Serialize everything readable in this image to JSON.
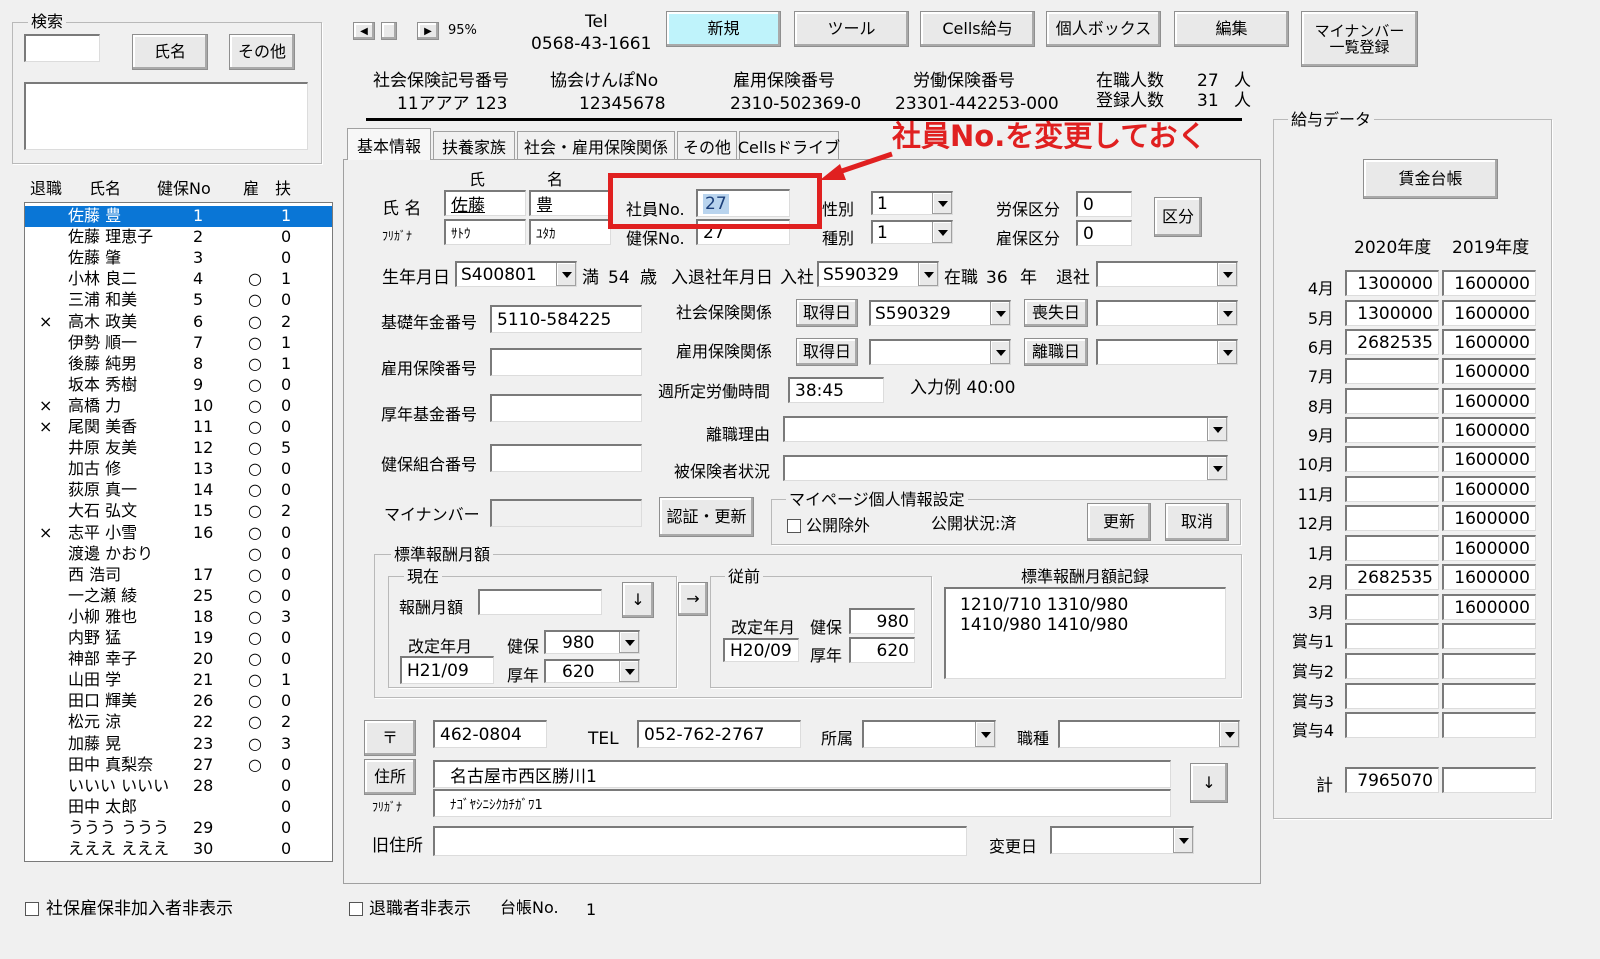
{
  "search": {
    "group_title": "検索",
    "name_button": "氏名",
    "other_button": "その他"
  },
  "topbar": {
    "zoom": "95%",
    "tel_label": "Tel",
    "tel_value": "0568-43-1661",
    "buttons": [
      "新規",
      "ツール",
      "Cells給与",
      "個人ボックス",
      "編集"
    ],
    "mynumber_button_line1": "マイナンバー",
    "mynumber_button_line2": "一覧登録"
  },
  "company": {
    "shaho_label": "社会保険記号番号",
    "shaho_value": "11アアア 123",
    "kyokai_label": "協会けんぽNo",
    "kyokai_value": "12345678",
    "koyo_label": "雇用保険番号",
    "koyo_value": "2310-502369-0",
    "rodo_label": "労働保険番号",
    "rodo_value": "23301-442253-000",
    "zaishoku_label": "在職人数",
    "zaishoku_value": "27",
    "zaishoku_unit": "人",
    "toroku_label": "登録人数",
    "toroku_value": "31",
    "toroku_unit": "人"
  },
  "employee_list": {
    "headers": [
      "退職",
      "氏名",
      "健保No",
      "雇",
      "扶"
    ],
    "rows": [
      {
        "retired": "",
        "name": "佐藤 豊",
        "no": "1",
        "koyo": "",
        "fu": "1",
        "selected": true
      },
      {
        "retired": "",
        "name": "佐藤 理恵子",
        "no": "2",
        "koyo": "",
        "fu": "0"
      },
      {
        "retired": "",
        "name": "佐藤 肇",
        "no": "3",
        "koyo": "",
        "fu": "0"
      },
      {
        "retired": "",
        "name": "小林 良二",
        "no": "4",
        "koyo": "○",
        "fu": "1"
      },
      {
        "retired": "",
        "name": "三浦 和美",
        "no": "5",
        "koyo": "○",
        "fu": "0"
      },
      {
        "retired": "×",
        "name": "高木 政美",
        "no": "6",
        "koyo": "○",
        "fu": "2"
      },
      {
        "retired": "",
        "name": "伊勢 順一",
        "no": "7",
        "koyo": "○",
        "fu": "1"
      },
      {
        "retired": "",
        "name": "後藤 純男",
        "no": "8",
        "koyo": "○",
        "fu": "1"
      },
      {
        "retired": "",
        "name": "坂本 秀樹",
        "no": "9",
        "koyo": "○",
        "fu": "0"
      },
      {
        "retired": "×",
        "name": "高橋 力",
        "no": "10",
        "koyo": "○",
        "fu": "0"
      },
      {
        "retired": "×",
        "name": "尾関 美香",
        "no": "11",
        "koyo": "○",
        "fu": "0"
      },
      {
        "retired": "",
        "name": "井原 友美",
        "no": "12",
        "koyo": "○",
        "fu": "5"
      },
      {
        "retired": "",
        "name": "加古 修",
        "no": "13",
        "koyo": "○",
        "fu": "0"
      },
      {
        "retired": "",
        "name": "荻原 真一",
        "no": "14",
        "koyo": "○",
        "fu": "0"
      },
      {
        "retired": "",
        "name": "大石 弘文",
        "no": "15",
        "koyo": "○",
        "fu": "2"
      },
      {
        "retired": "×",
        "name": "志平 小雪",
        "no": "16",
        "koyo": "○",
        "fu": "0"
      },
      {
        "retired": "",
        "name": "渡邊 かおり",
        "no": "",
        "koyo": "○",
        "fu": "0"
      },
      {
        "retired": "",
        "name": "西 浩司",
        "no": "17",
        "koyo": "○",
        "fu": "0"
      },
      {
        "retired": "",
        "name": "一之瀬 綾",
        "no": "25",
        "koyo": "○",
        "fu": "0"
      },
      {
        "retired": "",
        "name": "小柳 雅也",
        "no": "18",
        "koyo": "○",
        "fu": "3"
      },
      {
        "retired": "",
        "name": "内野 猛",
        "no": "19",
        "koyo": "○",
        "fu": "0"
      },
      {
        "retired": "",
        "name": "神部 幸子",
        "no": "20",
        "koyo": "○",
        "fu": "0"
      },
      {
        "retired": "",
        "name": "山田 学",
        "no": "21",
        "koyo": "○",
        "fu": "1"
      },
      {
        "retired": "",
        "name": "田口 輝美",
        "no": "26",
        "koyo": "○",
        "fu": "0"
      },
      {
        "retired": "",
        "name": "松元 涼",
        "no": "22",
        "koyo": "○",
        "fu": "2"
      },
      {
        "retired": "",
        "name": "加藤 晃",
        "no": "23",
        "koyo": "○",
        "fu": "3"
      },
      {
        "retired": "",
        "name": "田中 真梨奈",
        "no": "27",
        "koyo": "○",
        "fu": "0"
      },
      {
        "retired": "",
        "name": "いいい いいい",
        "no": "28",
        "koyo": "",
        "fu": "0"
      },
      {
        "retired": "",
        "name": "田中 太郎",
        "no": "",
        "koyo": "",
        "fu": "0"
      },
      {
        "retired": "",
        "name": "ううう ううう",
        "no": "29",
        "koyo": "",
        "fu": "0"
      },
      {
        "retired": "",
        "name": "えええ えええ",
        "no": "30",
        "koyo": "",
        "fu": "0"
      }
    ]
  },
  "bottom": {
    "hide_unenrolled": "社保雇保非加入者非表示",
    "hide_retired": "退職者非表示",
    "daicho_label": "台帳No.",
    "daicho_value": "1"
  },
  "tabs": [
    "基本情報",
    "扶養家族",
    "社会・雇用保険関係",
    "その他",
    "Cellsドライブ"
  ],
  "annotation": {
    "text": "社員No.を変更しておく",
    "color": "#e02020"
  },
  "basic": {
    "sei_header": "氏",
    "mei_header": "名",
    "name_label": "氏 名",
    "sei": "佐藤",
    "mei": "豊",
    "kana_label": "ﾌﾘｶﾞﾅ",
    "sei_kana": "ｻﾄｳ",
    "mei_kana": "ﾕﾀｶ",
    "shain_no_label": "社員No.",
    "shain_no": "27",
    "kenpo_no_label": "健保No.",
    "kenpo_no": "27",
    "seibetsu_label": "性別",
    "seibetsu": "1",
    "shubetsu_label": "種別",
    "shubetsu": "1",
    "rouho_label": "労保区分",
    "rouho": "0",
    "koho_label": "雇保区分",
    "koho": "0",
    "kubun_button": "区分",
    "birth_label": "生年月日",
    "birth": "S400801",
    "age_prefix": "満",
    "age": "54",
    "age_unit": "歳",
    "nyutai_label": "入退社年月日",
    "nyusha_label": "入社",
    "nyusha": "S590329",
    "zaishoku_prefix": "在職",
    "zaishoku_years": "36",
    "zaishoku_unit": "年",
    "taisha_label": "退社",
    "taisha": "",
    "kiso_label": "基礎年金番号",
    "kiso": "5110-584225",
    "koyo_label": "雇用保険番号",
    "koyo": "",
    "kosei_label": "厚年基金番号",
    "kosei": "",
    "kumiai_label": "健保組合番号",
    "kumiai": "",
    "mynumber_label": "マイナンバー",
    "mynumber": "",
    "ninsho_button": "認証・更新",
    "shaho_label": "社会保険関係",
    "shutoku_button": "取得日",
    "shaho_shutoku": "S590329",
    "soshitsu_button": "喪失日",
    "shaho_soshitsu": "",
    "koyoho_label": "雇用保険関係",
    "koyo_shutoku": "",
    "rishoku_button": "離職日",
    "koyo_rishoku": "",
    "shotei_label": "週所定労働時間",
    "shotei": "38:45",
    "shotei_example": "入力例  40:00",
    "rishoku_reason_label": "離職理由",
    "rishoku_reason": "",
    "hihoken_label": "被保険者状況",
    "hihoken": "",
    "mypage": {
      "title": "マイページ個人情報設定",
      "exclude_label": "公開除外",
      "status": "公開状況:済",
      "update_button": "更新",
      "cancel_button": "取消"
    }
  },
  "hyojun": {
    "title": "標準報酬月額",
    "current_title": "現在",
    "houshu_label": "報酬月額",
    "houshu": "",
    "down_arrow": "↓",
    "right_arrow": "→",
    "kaitei_label": "改定年月",
    "kaitei": "H21/09",
    "kenpo_label": "健保",
    "kenpo": "980",
    "konen_label": "厚年",
    "konen": "620",
    "prev_title": "従前",
    "prev_kaitei_label": "改定年月",
    "prev_kaitei": "H20/09",
    "prev_kenpo_label": "健保",
    "prev_kenpo": "980",
    "prev_konen_label": "厚年",
    "prev_konen": "620",
    "record_title": "標準報酬月額記録",
    "record_line1": "1210/710  1310/980",
    "record_line2": "1410/980 1410/980"
  },
  "address": {
    "zip_button": "〒",
    "zip": "462-0804",
    "tel_label": "TEL",
    "tel": "052-762-2767",
    "shozoku_label": "所属",
    "shozoku": "",
    "shokushu_label": "職種",
    "shokushu": "",
    "jusho_button": "住所",
    "jusho": "名古屋市西区勝川1",
    "kana_label": "ﾌﾘｶﾞﾅ",
    "jusho_kana": "ﾅｺﾞﾔｼﾆｼｸｶﾁｶﾞﾜ1",
    "down_button": "↓",
    "old_label": "旧住所",
    "old": "",
    "henkou_label": "変更日",
    "henkou": ""
  },
  "salary": {
    "group_title": "給与データ",
    "ledger_button": "賃金台帳",
    "year1": "2020年度",
    "year2": "2019年度",
    "rows": [
      {
        "month": "4月",
        "v1": "1300000",
        "v2": "1600000"
      },
      {
        "month": "5月",
        "v1": "1300000",
        "v2": "1600000"
      },
      {
        "month": "6月",
        "v1": "2682535",
        "v2": "1600000"
      },
      {
        "month": "7月",
        "v1": "",
        "v2": "1600000"
      },
      {
        "month": "8月",
        "v1": "",
        "v2": "1600000"
      },
      {
        "month": "9月",
        "v1": "",
        "v2": "1600000"
      },
      {
        "month": "10月",
        "v1": "",
        "v2": "1600000"
      },
      {
        "month": "11月",
        "v1": "",
        "v2": "1600000"
      },
      {
        "month": "12月",
        "v1": "",
        "v2": "1600000"
      },
      {
        "month": "1月",
        "v1": "",
        "v2": "1600000"
      },
      {
        "month": "2月",
        "v1": "2682535",
        "v2": "1600000"
      },
      {
        "month": "3月",
        "v1": "",
        "v2": "1600000"
      },
      {
        "month": "賞与1",
        "v1": "",
        "v2": ""
      },
      {
        "month": "賞与2",
        "v1": "",
        "v2": ""
      },
      {
        "month": "賞与3",
        "v1": "",
        "v2": ""
      },
      {
        "month": "賞与4",
        "v1": "",
        "v2": ""
      }
    ],
    "total_label": "計",
    "total1": "7965070",
    "total2": ""
  }
}
